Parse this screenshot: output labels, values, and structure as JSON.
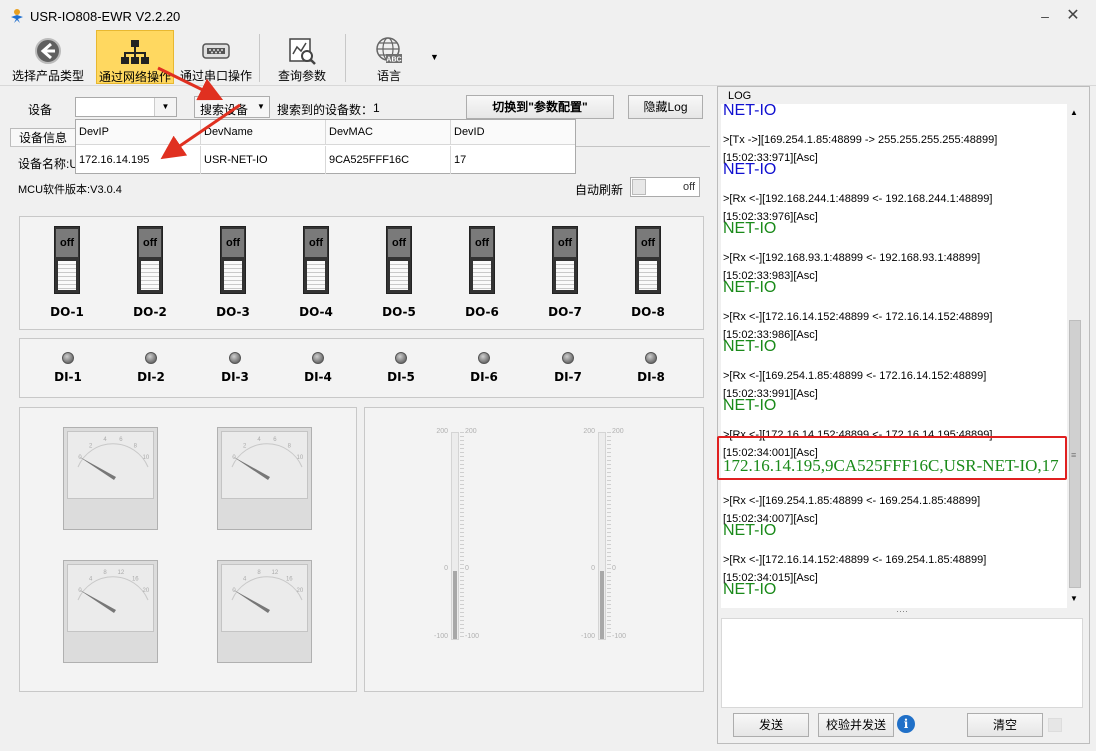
{
  "window": {
    "title": "USR-IO808-EWR V2.2.20"
  },
  "toolbar": {
    "items": [
      {
        "label": "选择产品类型",
        "icon": "back-arrow-icon"
      },
      {
        "label": "通过网络操作",
        "icon": "network-icon"
      },
      {
        "label": "通过串口操作",
        "icon": "serial-port-icon"
      },
      {
        "label": "查询参数",
        "icon": "query-chart-icon"
      },
      {
        "label": "语言",
        "icon": "globe-abc-icon"
      }
    ]
  },
  "device": {
    "label": "设备",
    "search_button": "搜索设备",
    "found_label": "搜索到的设备数：",
    "found_count": "1",
    "switch_button": "切换到\"参数配置\"",
    "hide_log_button": "隐藏Log"
  },
  "info": {
    "tab": "设备信息",
    "name_label": "设备名称:U",
    "mcu_version": "MCU软件版本:V3.0.4",
    "auto_refresh_label": "自动刷新",
    "auto_refresh_state": "off"
  },
  "device_table": {
    "columns": [
      "DevIP",
      "DevName",
      "DevMAC",
      "DevID"
    ],
    "rows": [
      [
        "172.16.14.195",
        "USR-NET-IO",
        "9CA525FFF16C",
        "17"
      ]
    ]
  },
  "outputs": [
    {
      "label": "DO-1",
      "state": "off"
    },
    {
      "label": "DO-2",
      "state": "off"
    },
    {
      "label": "DO-3",
      "state": "off"
    },
    {
      "label": "DO-4",
      "state": "off"
    },
    {
      "label": "DO-5",
      "state": "off"
    },
    {
      "label": "DO-6",
      "state": "off"
    },
    {
      "label": "DO-7",
      "state": "off"
    },
    {
      "label": "DO-8",
      "state": "off"
    }
  ],
  "inputs": [
    "DI-1",
    "DI-2",
    "DI-3",
    "DI-4",
    "DI-5",
    "DI-6",
    "DI-7",
    "DI-8"
  ],
  "gauges": {
    "thermo_top": "200",
    "thermo_zero": "0",
    "thermo_bottom": "-100",
    "meter1_ticks": [
      "0",
      "2",
      "4",
      "6",
      "8",
      "10"
    ],
    "meter3_ticks": [
      "0",
      "4",
      "8",
      "12",
      "16",
      "20"
    ]
  },
  "log": {
    "title": "LOG",
    "entries": [
      {
        "type": "net",
        "text": "NET-IO",
        "color": "#1010d0"
      },
      {
        "type": "line",
        "text": ">[Tx ->][169.254.1.85:48899 -> 255.255.255.255:48899]"
      },
      {
        "type": "line",
        "text": "[15:02:33:971][Asc]"
      },
      {
        "type": "net",
        "text": "NET-IO",
        "color": "#1010d0"
      },
      {
        "type": "line",
        "text": ">[Rx <-][192.168.244.1:48899 <- 192.168.244.1:48899]"
      },
      {
        "type": "line",
        "text": "[15:02:33:976][Asc]"
      },
      {
        "type": "net",
        "text": "NET-IO",
        "color": "#1a8a1a"
      },
      {
        "type": "line",
        "text": ">[Rx <-][192.168.93.1:48899 <- 192.168.93.1:48899]"
      },
      {
        "type": "line",
        "text": "[15:02:33:983][Asc]"
      },
      {
        "type": "net",
        "text": "NET-IO",
        "color": "#1a8a1a"
      },
      {
        "type": "line",
        "text": ">[Rx <-][172.16.14.152:48899 <- 172.16.14.152:48899]"
      },
      {
        "type": "line",
        "text": "[15:02:33:986][Asc]"
      },
      {
        "type": "net",
        "text": "NET-IO",
        "color": "#1a8a1a"
      },
      {
        "type": "line",
        "text": ">[Rx <-][169.254.1.85:48899 <- 172.16.14.152:48899]"
      },
      {
        "type": "line",
        "text": "[15:02:33:991][Asc]"
      },
      {
        "type": "net",
        "text": "NET-IO",
        "color": "#1a8a1a"
      },
      {
        "type": "line",
        "text": ">[Rx <-][172.16.14.152:48899 <- 172.16.14.195:48899]"
      },
      {
        "type": "line",
        "text": "[15:02:34:001][Asc]"
      },
      {
        "type": "big",
        "text": "172.16.14.195,9CA525FFF16C,USR-NET-IO,17",
        "color": "#1a8a1a"
      },
      {
        "type": "line",
        "text": ">[Rx <-][169.254.1.85:48899 <- 169.254.1.85:48899]"
      },
      {
        "type": "line",
        "text": "[15:02:34:007][Asc]"
      },
      {
        "type": "net",
        "text": "NET-IO",
        "color": "#1a8a1a"
      },
      {
        "type": "line",
        "text": ">[Rx <-][172.16.14.152:48899 <- 169.254.1.85:48899]"
      },
      {
        "type": "line",
        "text": "[15:02:34:015][Asc]"
      },
      {
        "type": "net",
        "text": "NET-IO",
        "color": "#1a8a1a"
      }
    ],
    "send_button": "发送",
    "checksum_send_button": "校验并发送",
    "clear_button": "清空",
    "splitter": "····"
  },
  "colors": {
    "highlight_box": "#e02020",
    "annotation_arrow": "#e03020"
  }
}
